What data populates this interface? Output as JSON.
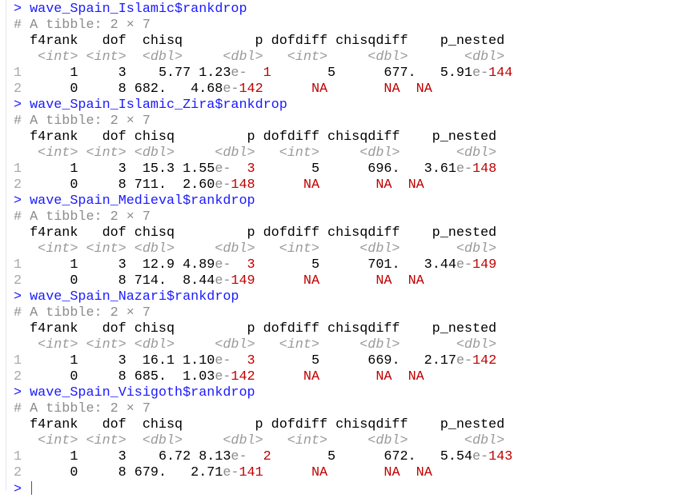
{
  "prompt": ">",
  "blocks": [
    {
      "command": "wave_Spain_Islamic$rankdrop",
      "description": "# A tibble: 2 × 7",
      "header": "  f4rank   dof  chisq         p dofdiff chisqdiff    p_nested",
      "types": "   <int> <int>  <dbl>     <dbl>   <int>     <dbl>       <dbl>",
      "rows": [
        [
          [
            "1",
            "idx"
          ],
          [
            "      1     3    5.77 1.23",
            "num"
          ],
          [
            "e-",
            "e"
          ],
          [
            "  1",
            "exp"
          ],
          [
            "       5      677.   5.91",
            "num"
          ],
          [
            "e-",
            "e"
          ],
          [
            "144",
            "exp"
          ]
        ],
        [
          [
            "2",
            "idx"
          ],
          [
            "      0     8 682.   4.68",
            "num"
          ],
          [
            "e-",
            "e"
          ],
          [
            "142",
            "exp"
          ],
          [
            "      ",
            "num"
          ],
          [
            "NA",
            "na"
          ],
          [
            "       ",
            "num"
          ],
          [
            "NA",
            "na"
          ],
          [
            "  ",
            "num"
          ],
          [
            "NA",
            "na"
          ]
        ]
      ]
    },
    {
      "command": "wave_Spain_Islamic_Zira$rankdrop",
      "description": "# A tibble: 2 × 7",
      "header": "  f4rank   dof chisq         p dofdiff chisqdiff    p_nested",
      "types": "   <int> <int> <dbl>     <dbl>   <int>     <dbl>       <dbl>",
      "rows": [
        [
          [
            "1",
            "idx"
          ],
          [
            "      1     3  15.3 1.55",
            "num"
          ],
          [
            "e-",
            "e"
          ],
          [
            "  3",
            "exp"
          ],
          [
            "       5      696.   3.61",
            "num"
          ],
          [
            "e-",
            "e"
          ],
          [
            "148",
            "exp"
          ]
        ],
        [
          [
            "2",
            "idx"
          ],
          [
            "      0     8 711.  2.60",
            "num"
          ],
          [
            "e-",
            "e"
          ],
          [
            "148",
            "exp"
          ],
          [
            "      ",
            "num"
          ],
          [
            "NA",
            "na"
          ],
          [
            "       ",
            "num"
          ],
          [
            "NA",
            "na"
          ],
          [
            "  ",
            "num"
          ],
          [
            "NA",
            "na"
          ]
        ]
      ]
    },
    {
      "command": "wave_Spain_Medieval$rankdrop",
      "description": "# A tibble: 2 × 7",
      "header": "  f4rank   dof chisq         p dofdiff chisqdiff    p_nested",
      "types": "   <int> <int> <dbl>     <dbl>   <int>     <dbl>       <dbl>",
      "rows": [
        [
          [
            "1",
            "idx"
          ],
          [
            "      1     3  12.9 4.89",
            "num"
          ],
          [
            "e-",
            "e"
          ],
          [
            "  3",
            "exp"
          ],
          [
            "       5      701.   3.44",
            "num"
          ],
          [
            "e-",
            "e"
          ],
          [
            "149",
            "exp"
          ]
        ],
        [
          [
            "2",
            "idx"
          ],
          [
            "      0     8 714.  8.44",
            "num"
          ],
          [
            "e-",
            "e"
          ],
          [
            "149",
            "exp"
          ],
          [
            "      ",
            "num"
          ],
          [
            "NA",
            "na"
          ],
          [
            "       ",
            "num"
          ],
          [
            "NA",
            "na"
          ],
          [
            "  ",
            "num"
          ],
          [
            "NA",
            "na"
          ]
        ]
      ]
    },
    {
      "command": "wave_Spain_Nazari$rankdrop",
      "description": "# A tibble: 2 × 7",
      "header": "  f4rank   dof chisq         p dofdiff chisqdiff    p_nested",
      "types": "   <int> <int> <dbl>     <dbl>   <int>     <dbl>       <dbl>",
      "rows": [
        [
          [
            "1",
            "idx"
          ],
          [
            "      1     3  16.1 1.10",
            "num"
          ],
          [
            "e-",
            "e"
          ],
          [
            "  3",
            "exp"
          ],
          [
            "       5      669.   2.17",
            "num"
          ],
          [
            "e-",
            "e"
          ],
          [
            "142",
            "exp"
          ]
        ],
        [
          [
            "2",
            "idx"
          ],
          [
            "      0     8 685.  1.03",
            "num"
          ],
          [
            "e-",
            "e"
          ],
          [
            "142",
            "exp"
          ],
          [
            "      ",
            "num"
          ],
          [
            "NA",
            "na"
          ],
          [
            "       ",
            "num"
          ],
          [
            "NA",
            "na"
          ],
          [
            "  ",
            "num"
          ],
          [
            "NA",
            "na"
          ]
        ]
      ]
    },
    {
      "command": "wave_Spain_Visigoth$rankdrop",
      "description": "# A tibble: 2 × 7",
      "header": "  f4rank   dof  chisq         p dofdiff chisqdiff    p_nested",
      "types": "   <int> <int>  <dbl>     <dbl>   <int>     <dbl>       <dbl>",
      "rows": [
        [
          [
            "1",
            "idx"
          ],
          [
            "      1     3    6.72 8.13",
            "num"
          ],
          [
            "e-",
            "e"
          ],
          [
            "  2",
            "exp"
          ],
          [
            "       5      672.   5.54",
            "num"
          ],
          [
            "e-",
            "e"
          ],
          [
            "143",
            "exp"
          ]
        ],
        [
          [
            "2",
            "idx"
          ],
          [
            "      0     8 679.   2.71",
            "num"
          ],
          [
            "e-",
            "e"
          ],
          [
            "141",
            "exp"
          ],
          [
            "      ",
            "num"
          ],
          [
            "NA",
            "na"
          ],
          [
            "       ",
            "num"
          ],
          [
            "NA",
            "na"
          ],
          [
            "  ",
            "num"
          ],
          [
            "NA",
            "na"
          ]
        ]
      ]
    }
  ]
}
